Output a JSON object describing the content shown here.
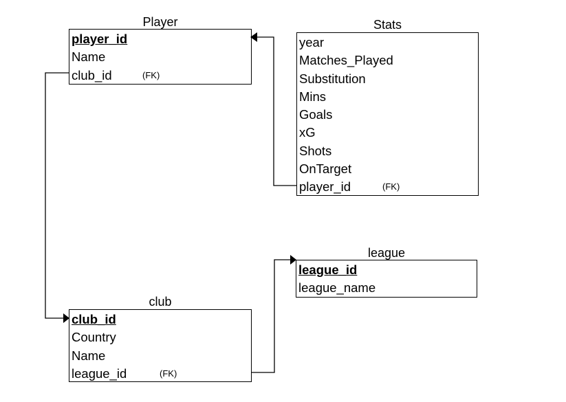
{
  "diagram": {
    "entities": {
      "player": {
        "title": "Player",
        "fields": [
          {
            "name": "player_id",
            "pk": true,
            "fk": ""
          },
          {
            "name": "Name",
            "pk": false,
            "fk": ""
          },
          {
            "name": "club_id",
            "pk": false,
            "fk": "(FK)"
          }
        ]
      },
      "stats": {
        "title": "Stats",
        "fields": [
          {
            "name": "year",
            "pk": false,
            "fk": ""
          },
          {
            "name": "Matches_Played",
            "pk": false,
            "fk": ""
          },
          {
            "name": "Substitution",
            "pk": false,
            "fk": ""
          },
          {
            "name": "Mins",
            "pk": false,
            "fk": ""
          },
          {
            "name": "Goals",
            "pk": false,
            "fk": ""
          },
          {
            "name": "xG",
            "pk": false,
            "fk": ""
          },
          {
            "name": "Shots",
            "pk": false,
            "fk": ""
          },
          {
            "name": "OnTarget",
            "pk": false,
            "fk": ""
          },
          {
            "name": "player_id",
            "pk": false,
            "fk": "(FK)"
          }
        ]
      },
      "club": {
        "title": "club",
        "fields": [
          {
            "name": "club_id",
            "pk": true,
            "fk": ""
          },
          {
            "name": "Country",
            "pk": false,
            "fk": ""
          },
          {
            "name": "Name",
            "pk": false,
            "fk": ""
          },
          {
            "name": "league_id",
            "pk": false,
            "fk": "(FK)"
          }
        ]
      },
      "league": {
        "title": "league",
        "fields": [
          {
            "name": "league_id",
            "pk": true,
            "fk": ""
          },
          {
            "name": "league_name",
            "pk": false,
            "fk": ""
          }
        ]
      }
    },
    "relationships": [
      {
        "from": "stats.player_id",
        "to": "player.player_id"
      },
      {
        "from": "player.club_id",
        "to": "club.club_id"
      },
      {
        "from": "club.league_id",
        "to": "league.league_id"
      }
    ]
  }
}
